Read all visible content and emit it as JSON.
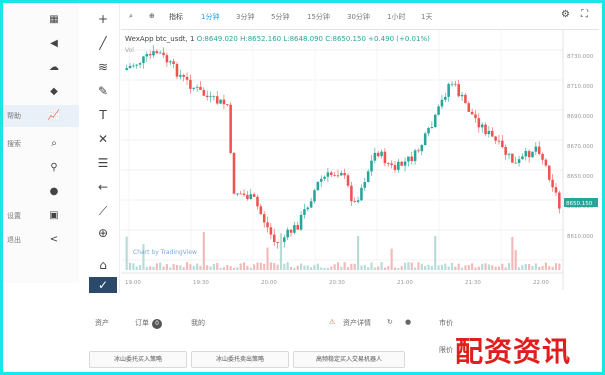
{
  "left_nav": {
    "items": [
      {
        "label": "",
        "icon": "grid-icon"
      },
      {
        "label": "",
        "icon": "speaker-icon"
      },
      {
        "label": "",
        "icon": "cloud-icon"
      },
      {
        "label": "",
        "icon": "shield-icon"
      },
      {
        "label": "帮助",
        "icon": "chart-icon"
      },
      {
        "label": "搜索",
        "icon": "search-icon"
      },
      {
        "label": "",
        "icon": "key-icon"
      },
      {
        "label": "",
        "icon": "chat-icon"
      },
      {
        "label": "设置",
        "icon": "user-icon"
      },
      {
        "label": "退出",
        "icon": "share-icon"
      }
    ]
  },
  "toolbar": {
    "indicators_label": "指标",
    "intervals": [
      "1分钟",
      "3分钟",
      "5分钟",
      "15分钟",
      "30分钟",
      "1小时",
      "1天"
    ]
  },
  "chart": {
    "symbol_line": "WexApp btc_usdt, 1",
    "open": "O:8649.020",
    "high": "H:8652.160",
    "low": "L:8648.090",
    "close": "C:8650.150",
    "change": "+0.490 (+0.01%)",
    "volume_line": "Vol",
    "watermark": "Chart by TradingView",
    "last_price": "8650.150",
    "price_ticks": [
      "8730.000",
      "8710.000",
      "8690.000",
      "8670.000",
      "8650.000",
      "8630.000",
      "8610.000"
    ],
    "time_ticks": [
      "19:00",
      "19:30",
      "20:00",
      "20:30",
      "21:00",
      "21:30",
      "22:00"
    ]
  },
  "bottom": {
    "tabs": [
      "资产",
      "订单",
      "我的"
    ],
    "order_count": "0",
    "right_label": "资产详情",
    "buttons": [
      "冰山委托买入策略",
      "冰山委托卖出策略",
      "高频稳定买入交易机器人"
    ],
    "side_labels": [
      "市价",
      "限价"
    ]
  },
  "brand_text": "配资资讯",
  "colors": {
    "accent": "#1e9cf0",
    "up": "#26a69a",
    "down": "#ef5350",
    "brand": "#e11d1d",
    "frame": "#19e6e6"
  }
}
